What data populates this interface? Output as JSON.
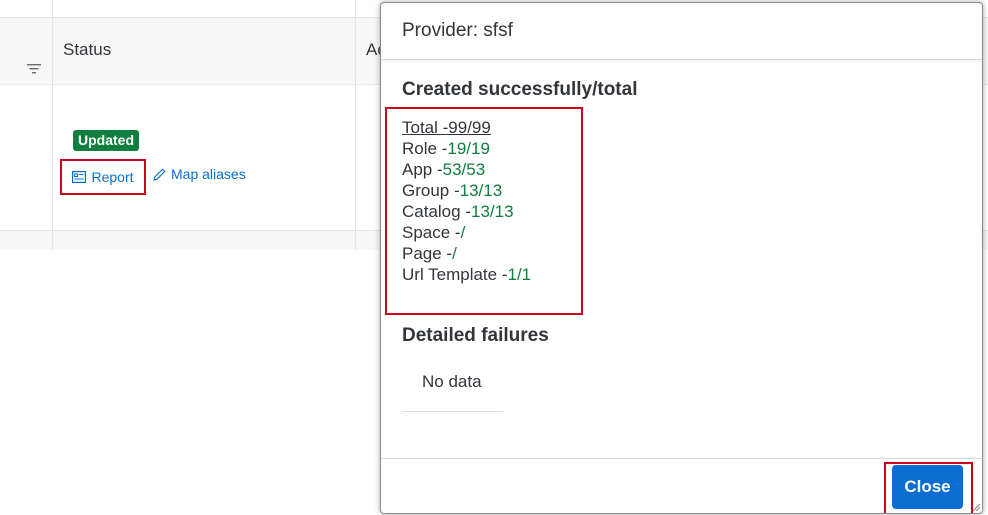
{
  "table": {
    "status_header": "Status",
    "next_header_partial": "Ac",
    "row": {
      "badge": "Updated",
      "report_link": "Report",
      "map_aliases_link": "Map aliases"
    }
  },
  "dialog": {
    "title": "Provider: sfsf",
    "created_section_title": "Created successfully/total",
    "stats": [
      {
        "label": "Total -",
        "value": "99/99"
      },
      {
        "label": "Role -",
        "value": "19/19"
      },
      {
        "label": "App -",
        "value": "53/53"
      },
      {
        "label": "Group -",
        "value": "13/13"
      },
      {
        "label": "Catalog -",
        "value": "13/13"
      },
      {
        "label": "Space -",
        "value": "/"
      },
      {
        "label": "Page -",
        "value": "/"
      },
      {
        "label": "Url Template -",
        "value": "1/1"
      }
    ],
    "failures_section_title": "Detailed failures",
    "no_data_text": "No data",
    "close_label": "Close"
  },
  "colors": {
    "success_green": "#107e3e",
    "link_blue": "#0a6ed1",
    "highlight_red": "#d0021b"
  }
}
